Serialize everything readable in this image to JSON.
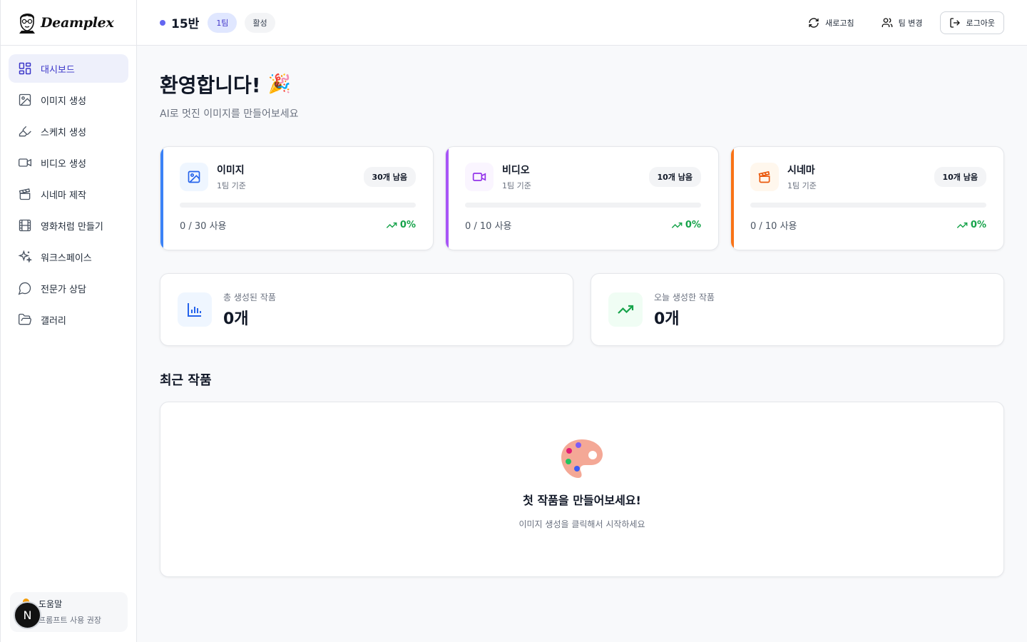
{
  "brand": {
    "name": "Deamplex"
  },
  "sidebar": {
    "items": [
      {
        "label": "대시보드",
        "icon": "dashboard-icon",
        "active": true
      },
      {
        "label": "이미지 생성",
        "icon": "image-icon"
      },
      {
        "label": "스케치 생성",
        "icon": "brush-icon"
      },
      {
        "label": "비디오 생성",
        "icon": "video-icon"
      },
      {
        "label": "시네마 제작",
        "icon": "clapperboard-icon"
      },
      {
        "label": "영화처럼 만들기",
        "icon": "film-icon"
      },
      {
        "label": "워크스페이스",
        "icon": "sparkles-icon"
      },
      {
        "label": "전문가 상담",
        "icon": "chat-bubble-icon"
      },
      {
        "label": "갤러리",
        "icon": "folder-icon"
      }
    ],
    "help": {
      "title": "도움말",
      "subtitle": "프롬프트 사용 권장"
    },
    "avatar_letter": "N"
  },
  "header": {
    "class_name": "15반",
    "team_badge": "1팀",
    "status_badge": "활성",
    "refresh_label": "새로고침",
    "change_team_label": "팀 변경",
    "logout_label": "로그아웃"
  },
  "welcome": {
    "title": "환영합니다!",
    "emoji": "🎉",
    "subtitle": "AI로 멋진 이미지를 만들어보세요"
  },
  "quotas": [
    {
      "title": "이미지",
      "basis": "1팀 기준",
      "remaining": "30개 남음",
      "usage": "0 / 30 사용",
      "percent": "0%",
      "fraction": 0,
      "color": "#3b82f6",
      "icon": "image-icon"
    },
    {
      "title": "비디오",
      "basis": "1팀 기준",
      "remaining": "10개 남음",
      "usage": "0 / 10 사용",
      "percent": "0%",
      "fraction": 0,
      "color": "#a855f7",
      "icon": "video-icon"
    },
    {
      "title": "시네마",
      "basis": "1팀 기준",
      "remaining": "10개 남음",
      "usage": "0 / 10 사용",
      "percent": "0%",
      "fraction": 0,
      "color": "#f97316",
      "icon": "clapperboard-icon"
    }
  ],
  "stats": [
    {
      "label": "총 생성된 작품",
      "value": "0개",
      "icon": "bar-chart-icon",
      "color": "#3b82f6"
    },
    {
      "label": "오늘 생성한 작품",
      "value": "0개",
      "icon": "trending-up-icon",
      "color": "#16a34a"
    }
  ],
  "recent": {
    "title": "최근 작품",
    "empty_icon": "palette-icon",
    "empty_title": "첫 작품을 만들어보세요!",
    "empty_subtitle": "이미지 생성을 클릭해서 시작하세요"
  }
}
